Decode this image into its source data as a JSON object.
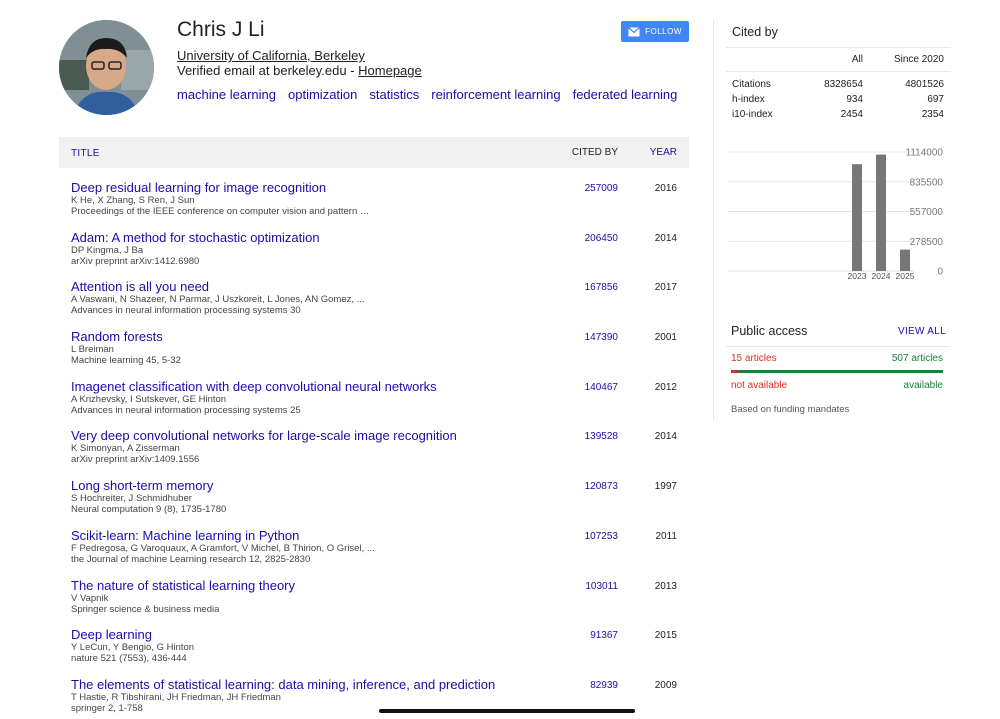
{
  "profile": {
    "name": "Chris J Li",
    "affiliation": "University of California, Berkeley",
    "email_prefix": "Verified email at berkeley.edu - ",
    "homepage": "Homepage",
    "interests": [
      "machine learning",
      "optimization",
      "statistics",
      "reinforcement learning",
      "federated learning"
    ],
    "follow_label": "FOLLOW"
  },
  "table": {
    "headers": {
      "title": "TITLE",
      "cited_by": "CITED BY",
      "year": "YEAR"
    },
    "articles": [
      {
        "title": "Deep residual learning for image recognition",
        "authors": "K He, X Zhang, S Ren, J Sun",
        "venue": "Proceedings of the IEEE conference on computer vision and pattern …",
        "cited_by": "257009",
        "year": "2016"
      },
      {
        "title": "Adam: A method for stochastic optimization",
        "authors": "DP Kingma, J Ba",
        "venue": "arXiv preprint arXiv:1412.6980",
        "cited_by": "206450",
        "year": "2014"
      },
      {
        "title": "Attention is all you need",
        "authors": "A Vaswani, N Shazeer, N Parmar, J Uszkoreit, L Jones, AN Gomez, ...",
        "venue": "Advances in neural information processing systems 30",
        "cited_by": "167856",
        "year": "2017"
      },
      {
        "title": "Random forests",
        "authors": "L Breiman",
        "venue": "Machine learning 45, 5-32",
        "cited_by": "147390",
        "year": "2001"
      },
      {
        "title": "Imagenet classification with deep convolutional neural networks",
        "authors": "A Krizhevsky, I Sutskever, GE Hinton",
        "venue": "Advances in neural information processing systems 25",
        "cited_by": "140467",
        "year": "2012"
      },
      {
        "title": "Very deep convolutional networks for large-scale image recognition",
        "authors": "K Simonyan, A Zisserman",
        "venue": "arXiv preprint arXiv:1409.1556",
        "cited_by": "139528",
        "year": "2014"
      },
      {
        "title": "Long short-term memory",
        "authors": "S Hochreiter, J Schmidhuber",
        "venue": "Neural computation 9 (8), 1735-1780",
        "cited_by": "120873",
        "year": "1997"
      },
      {
        "title": "Scikit-learn: Machine learning in Python",
        "authors": "F Pedregosa, G Varoquaux, A Gramfort, V Michel, B Thirion, O Grisel, ...",
        "venue": "the Journal of machine Learning research 12, 2825-2830",
        "cited_by": "107253",
        "year": "2011"
      },
      {
        "title": "The nature of statistical learning theory",
        "authors": "V Vapnik",
        "venue": "Springer science & business media",
        "cited_by": "103011",
        "year": "2013"
      },
      {
        "title": "Deep learning",
        "authors": "Y LeCun, Y Bengio, G Hinton",
        "venue": "nature 521 (7553), 436-444",
        "cited_by": "91367",
        "year": "2015"
      },
      {
        "title": "The elements of statistical learning: data mining, inference, and prediction",
        "authors": "T Hastie, R Tibshirani, JH Friedman, JH Friedman",
        "venue": "springer 2, 1-758",
        "cited_by": "82939",
        "year": "2009"
      }
    ]
  },
  "cited_by": {
    "title": "Cited by",
    "col_all": "All",
    "col_since": "Since 2020",
    "rows": [
      {
        "label": "Citations",
        "all": "8328654",
        "since": "4801526"
      },
      {
        "label": "h-index",
        "all": "934",
        "since": "697"
      },
      {
        "label": "i10-index",
        "all": "2454",
        "since": "2354"
      }
    ]
  },
  "chart_data": {
    "type": "bar",
    "categories": [
      "2023",
      "2024",
      "2025"
    ],
    "values": [
      1000000,
      1090000,
      200000
    ],
    "y_ticks": [
      "1114000",
      "835500",
      "557000",
      "278500",
      "0"
    ],
    "ylim": [
      0,
      1114000
    ],
    "bar_color": "#777777",
    "grid": true
  },
  "public_access": {
    "title": "Public access",
    "view_all": "VIEW ALL",
    "not_available_count": "15 articles",
    "available_count": "507 articles",
    "not_available_label": "not available",
    "available_label": "available",
    "available_fraction": 0.971,
    "funding_note": "Based on funding mandates"
  },
  "colors": {
    "link": "#1a0dab",
    "follow_button": "#4285f4",
    "not_available": "#d93025",
    "available": "#188038"
  }
}
